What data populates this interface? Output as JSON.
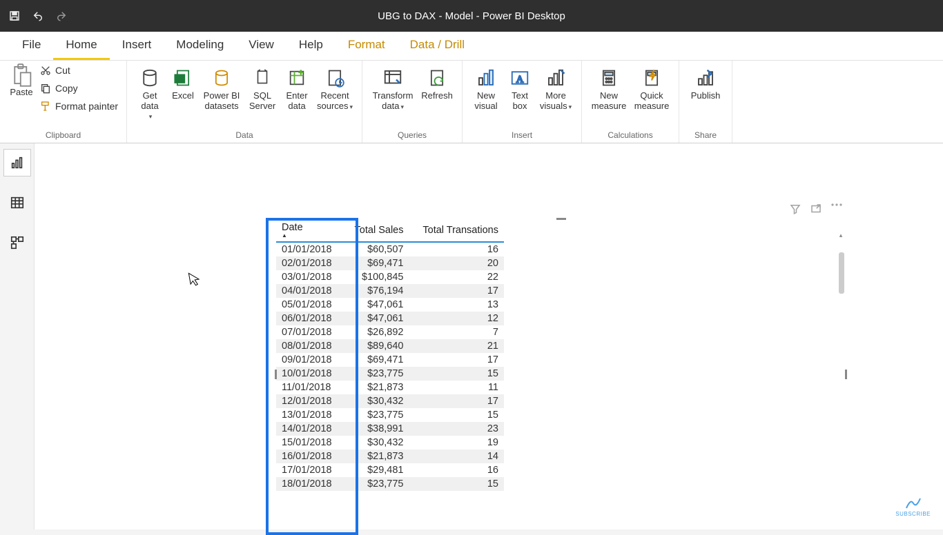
{
  "titlebar": {
    "title": "UBG to DAX - Model - Power BI Desktop"
  },
  "tabs": {
    "file": "File",
    "home": "Home",
    "insert": "Insert",
    "modeling": "Modeling",
    "view": "View",
    "help": "Help",
    "format": "Format",
    "datadrill": "Data / Drill"
  },
  "ribbon": {
    "clipboard": {
      "paste": "Paste",
      "cut": "Cut",
      "copy": "Copy",
      "format_painter": "Format painter",
      "group": "Clipboard"
    },
    "data": {
      "get_data": "Get data",
      "excel": "Excel",
      "pbi_datasets": "Power BI datasets",
      "sql_server": "SQL Server",
      "enter_data": "Enter data",
      "recent_sources": "Recent sources",
      "group": "Data"
    },
    "queries": {
      "transform": "Transform data",
      "refresh": "Refresh",
      "group": "Queries"
    },
    "insert": {
      "new_visual": "New visual",
      "text_box": "Text box",
      "more_visuals": "More visuals",
      "group": "Insert"
    },
    "calc": {
      "new_measure": "New measure",
      "quick_measure": "Quick measure",
      "group": "Calculations"
    },
    "share": {
      "publish": "Publish",
      "group": "Share"
    }
  },
  "table": {
    "headers": {
      "date": "Date",
      "sales": "Total Sales",
      "trans": "Total Transations"
    },
    "rows": [
      {
        "date": "01/01/2018",
        "sales": "$60,507",
        "trans": "16"
      },
      {
        "date": "02/01/2018",
        "sales": "$69,471",
        "trans": "20"
      },
      {
        "date": "03/01/2018",
        "sales": "$100,845",
        "trans": "22"
      },
      {
        "date": "04/01/2018",
        "sales": "$76,194",
        "trans": "17"
      },
      {
        "date": "05/01/2018",
        "sales": "$47,061",
        "trans": "13"
      },
      {
        "date": "06/01/2018",
        "sales": "$47,061",
        "trans": "12"
      },
      {
        "date": "07/01/2018",
        "sales": "$26,892",
        "trans": "7"
      },
      {
        "date": "08/01/2018",
        "sales": "$89,640",
        "trans": "21"
      },
      {
        "date": "09/01/2018",
        "sales": "$69,471",
        "trans": "17"
      },
      {
        "date": "10/01/2018",
        "sales": "$23,775",
        "trans": "15"
      },
      {
        "date": "11/01/2018",
        "sales": "$21,873",
        "trans": "11"
      },
      {
        "date": "12/01/2018",
        "sales": "$30,432",
        "trans": "17"
      },
      {
        "date": "13/01/2018",
        "sales": "$23,775",
        "trans": "15"
      },
      {
        "date": "14/01/2018",
        "sales": "$38,991",
        "trans": "23"
      },
      {
        "date": "15/01/2018",
        "sales": "$30,432",
        "trans": "19"
      },
      {
        "date": "16/01/2018",
        "sales": "$21,873",
        "trans": "14"
      },
      {
        "date": "17/01/2018",
        "sales": "$29,481",
        "trans": "16"
      },
      {
        "date": "18/01/2018",
        "sales": "$23,775",
        "trans": "15"
      }
    ]
  },
  "subscribe": "SUBSCRIBE"
}
